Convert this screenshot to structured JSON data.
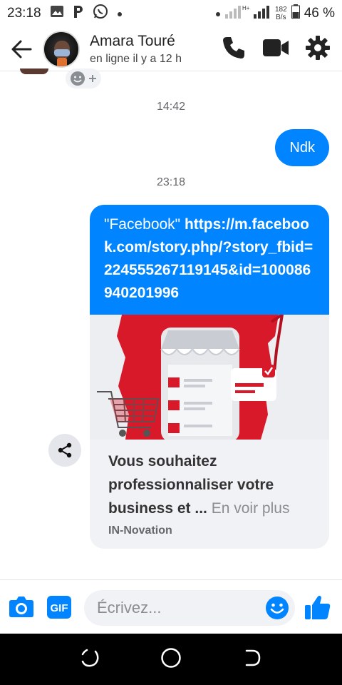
{
  "status_bar": {
    "time": "23:18",
    "data_speed_value": "182",
    "data_speed_unit": "B/s",
    "battery": "46 %"
  },
  "header": {
    "contact_name": "Amara Touré",
    "contact_status": "en ligne il y a 12 h"
  },
  "messages": {
    "timestamp_1": "14:42",
    "outgoing_1": "Ndk",
    "timestamp_2": "23:18",
    "link_quote": "\"Facebook\"",
    "link_url": "https://m.facebook.com/story.php/?story_fbid=224555267119145&id=100086940201996",
    "preview_title": "Vous souhaitez professionnaliser votre business et ...",
    "preview_more": "En voir plus",
    "preview_source": "IN-Novation"
  },
  "composer": {
    "placeholder": "Écrivez..."
  },
  "colors": {
    "messenger_blue": "#0084ff",
    "bubble_bg": "#f0f2f5"
  },
  "icons": {
    "back": "arrow-left",
    "call": "phone",
    "video": "video-camera",
    "settings": "gear",
    "camera": "camera",
    "gif": "gif",
    "emoji": "smiley",
    "like": "thumbs-up",
    "share": "share"
  }
}
